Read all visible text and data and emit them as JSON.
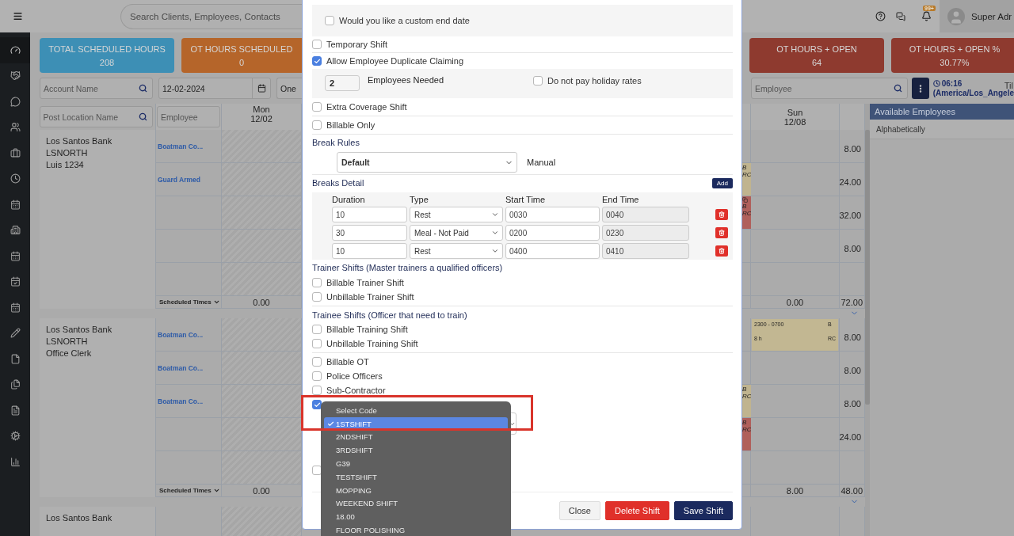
{
  "topbar": {
    "search_placeholder": "Search Clients, Employees, Contacts",
    "notification_badge": "99+",
    "user_name": "Super Adr"
  },
  "sidebar": {
    "items": [
      {
        "selected": true
      },
      {
        "selected": false
      },
      {
        "selected": false
      },
      {
        "selected": false
      },
      {
        "selected": false
      },
      {
        "selected": false
      },
      {
        "selected": false
      },
      {
        "selected": false
      },
      {
        "selected": false
      },
      {
        "selected": false
      },
      {
        "selected": false
      },
      {
        "selected": false
      },
      {
        "selected": false
      },
      {
        "selected": false
      },
      {
        "selected": false
      },
      {
        "selected": false
      },
      {
        "selected": false
      }
    ]
  },
  "stats_left": [
    {
      "label": "TOTAL SCHEDULED HOURS",
      "value": "208",
      "color": "#3d8fb5"
    },
    {
      "label": "OT HOURS SCHEDULED",
      "value": "0",
      "color": "#b5652a"
    }
  ],
  "stats_right": [
    {
      "label": "OT HOURS + OPEN",
      "value": "64",
      "color": "#8e3a2f"
    },
    {
      "label": "OT HOURS + OPEN %",
      "value": "30.77%",
      "color": "#8e3a2f"
    }
  ],
  "filters": {
    "account_placeholder": "Account Name",
    "date": "12-02-2024",
    "view": "One",
    "post_location_placeholder": "Post Location Name",
    "employee_column_placeholder": "Employee",
    "employee_search_placeholder": "Employee",
    "clock_time": "06:16",
    "clock_zone": "(America/Los_Angele",
    "clipped_label": "Til"
  },
  "grid": {
    "first_day": {
      "day": "Mon",
      "date": "12/02"
    },
    "last_day": {
      "day": "Sun",
      "date": "12/08"
    },
    "sections": [
      {
        "account": "Los Santos Bank",
        "location": "LSNORTH",
        "detail": "Luis 1234",
        "scheduled_label": "Scheduled Times",
        "first_total": "0.00",
        "last_total": "0.00",
        "week_total": "72.00",
        "rows": [
          {
            "employee": "Boatman Co...",
            "total": "8.00"
          },
          {
            "employee": "Guard Armed",
            "total": "24.00",
            "sliver": {
              "color": "#c0b48f",
              "flag": "B",
              "code": "RC",
              "copied": false
            }
          },
          {
            "total": "32.00",
            "sliver": {
              "color": "#b0605c",
              "flag": "B",
              "code": "RC",
              "copied": true
            }
          },
          {
            "total": "8.00"
          },
          {}
        ]
      },
      {
        "account": "Los Santos Bank",
        "location": "LSNORTH",
        "detail": "Office Clerk",
        "scheduled_label": "Scheduled Times",
        "first_total": "0.00",
        "last_total": "8.00",
        "week_total": "48.00",
        "rows": [
          {
            "employee": "Boatman Co...",
            "total": "8.00",
            "shift": {
              "time": "2300 - 0700",
              "hours": "8 h",
              "flag": "B",
              "code": "RC",
              "color": "#c2b792"
            }
          },
          {
            "employee": "Boatman Co...",
            "total": "8.00"
          },
          {
            "employee": "Boatman Co...",
            "total": "8.00",
            "sliver": {
              "color": "#c0b48f",
              "flag": "B",
              "code": "RC",
              "copied": false
            }
          },
          {
            "total": "24.00",
            "sliver": {
              "color": "#b0605c",
              "flag": "B",
              "code": "RC",
              "copied": false
            }
          },
          {}
        ]
      },
      {
        "account": "Los Santos Bank"
      }
    ]
  },
  "available": {
    "title": "Available Employees",
    "sort": "Alphabetically"
  },
  "modal": {
    "custom_end_date": {
      "label": "Would you like a custom end date",
      "checked": false
    },
    "options_a": [
      {
        "label": "Temporary Shift",
        "checked": false
      },
      {
        "label": "Allow Employee Duplicate Claiming",
        "checked": true
      }
    ],
    "employees_needed": {
      "value": "2",
      "label": "Employees Needed"
    },
    "holiday": {
      "label": "Do not pay holiday rates",
      "checked": false
    },
    "options_b": [
      {
        "label": "Extra Coverage Shift",
        "checked": false
      },
      {
        "label": "Billable Only",
        "checked": false
      }
    ],
    "break_rules": {
      "heading": "Break Rules",
      "value": "Default",
      "mode": "Manual"
    },
    "breaks": {
      "heading": "Breaks Detail",
      "add": "Add",
      "columns": [
        "Duration",
        "Type",
        "Start Time",
        "End Time"
      ],
      "rows": [
        {
          "duration": "10",
          "type": "Rest",
          "start": "0030",
          "end": "0040"
        },
        {
          "duration": "30",
          "type": "Meal - Not Paid",
          "start": "0200",
          "end": "0230"
        },
        {
          "duration": "10",
          "type": "Rest",
          "start": "0400",
          "end": "0410"
        }
      ]
    },
    "trainer": {
      "heading": "Trainer Shifts (Master trainers a qualified officers)",
      "options": [
        {
          "label": "Billable Trainer Shift",
          "checked": false
        },
        {
          "label": "Unbillable Trainer Shift",
          "checked": false
        }
      ]
    },
    "trainee": {
      "heading": "Trainee Shifts (Officer that need to train)",
      "options": [
        {
          "label": "Billable Training Shift",
          "checked": false
        },
        {
          "label": "Unbillable Training Shift",
          "checked": false
        }
      ]
    },
    "options_c": [
      {
        "label": "Billable OT",
        "checked": false
      },
      {
        "label": "Police Officers",
        "checked": false
      },
      {
        "label": "Sub-Contractor",
        "checked": false
      }
    ],
    "code_option": {
      "checked": true
    },
    "last_option": {
      "checked": false
    },
    "buttons": [
      {
        "label": "Close",
        "kind": "default"
      },
      {
        "label": "Delete Shift",
        "kind": "danger"
      },
      {
        "label": "Save Shift",
        "kind": "primary"
      }
    ]
  },
  "code_menu": {
    "items": [
      {
        "label": "Select Code",
        "selected": false
      },
      {
        "label": "1STSHIFT",
        "selected": true
      },
      {
        "label": "2NDSHIFT",
        "selected": false
      },
      {
        "label": "3RDSHIFT",
        "selected": false
      },
      {
        "label": "G39",
        "selected": false
      },
      {
        "label": "TESTSHIFT",
        "selected": false
      },
      {
        "label": "MOPPING",
        "selected": false
      },
      {
        "label": "WEEKEND SHIFT",
        "selected": false
      },
      {
        "label": "18.00",
        "selected": false
      },
      {
        "label": "FLOOR POLISHING",
        "selected": false
      }
    ]
  }
}
